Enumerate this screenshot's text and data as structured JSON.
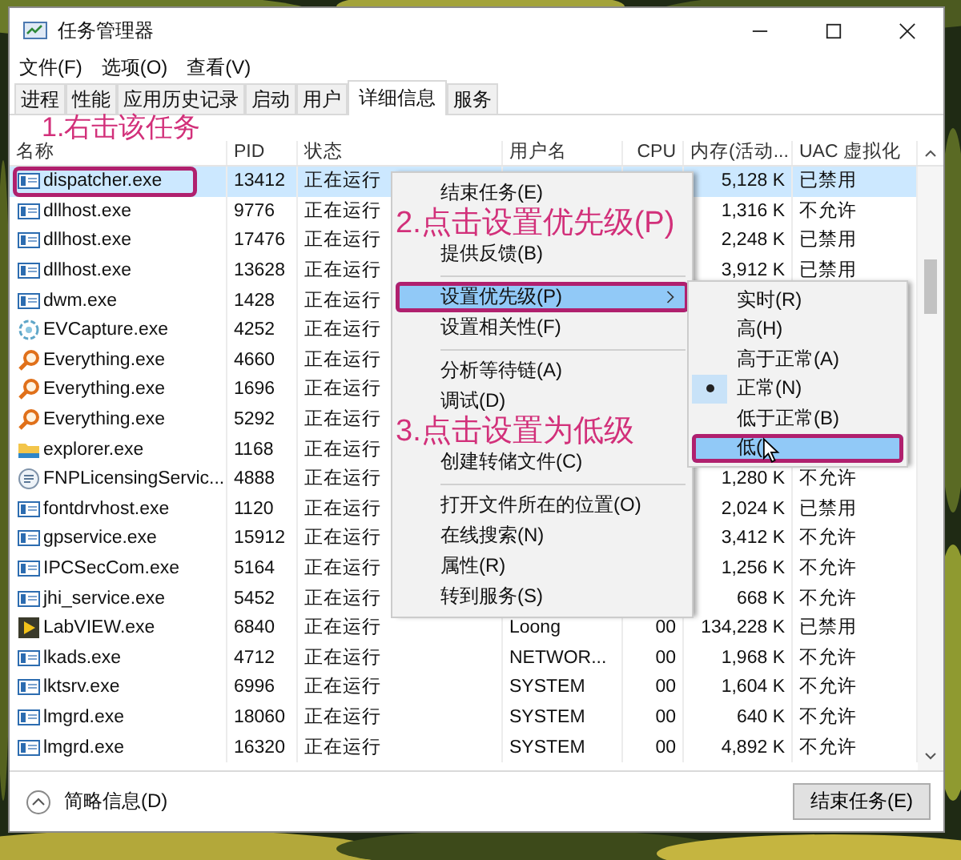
{
  "window": {
    "title": "任务管理器"
  },
  "menu_bar": [
    "文件(F)",
    "选项(O)",
    "查看(V)"
  ],
  "tabs": [
    {
      "label": "进程",
      "selected": false
    },
    {
      "label": "性能",
      "selected": false
    },
    {
      "label": "应用历史记录",
      "selected": false
    },
    {
      "label": "启动",
      "selected": false
    },
    {
      "label": "用户",
      "selected": false
    },
    {
      "label": "详细信息",
      "selected": true
    },
    {
      "label": "服务",
      "selected": false
    }
  ],
  "annotation": "1.右击该任务",
  "table": {
    "columns": [
      "名称",
      "PID",
      "状态",
      "用户名",
      "CPU",
      "内存(活动...",
      "UAC 虚拟化"
    ],
    "rows": [
      {
        "kind": "app",
        "name": "dispatcher.exe",
        "pid": "13412",
        "status": "正在运行",
        "memory": "5,128 K",
        "uac": "已禁用",
        "selected": true
      },
      {
        "kind": "app",
        "name": "dllhost.exe",
        "pid": "9776",
        "status": "正在运行",
        "memory": "1,316 K",
        "uac": "不允许",
        "selected": false
      },
      {
        "kind": "app",
        "name": "dllhost.exe",
        "pid": "17476",
        "status": "正在运行",
        "memory": "2,248 K",
        "uac": "已禁用",
        "selected": false
      },
      {
        "kind": "app",
        "name": "dllhost.exe",
        "pid": "13628",
        "status": "正在运行",
        "memory": "3,912 K",
        "uac": "已禁用",
        "selected": false
      },
      {
        "kind": "app",
        "name": "dwm.exe",
        "pid": "1428",
        "status": "正在运行",
        "selected": false
      },
      {
        "kind": "capture",
        "name": "EVCapture.exe",
        "pid": "4252",
        "status": "正在运行",
        "selected": false
      },
      {
        "kind": "search",
        "name": "Everything.exe",
        "pid": "4660",
        "status": "正在运行",
        "selected": false
      },
      {
        "kind": "search",
        "name": "Everything.exe",
        "pid": "1696",
        "status": "正在运行",
        "selected": false
      },
      {
        "kind": "search",
        "name": "Everything.exe",
        "pid": "5292",
        "status": "正在运行",
        "selected": false
      },
      {
        "kind": "folder",
        "name": "explorer.exe",
        "pid": "1168",
        "status": "正在运行",
        "selected": false
      },
      {
        "kind": "service",
        "name": "FNPLicensingServic...",
        "pid": "4888",
        "status": "正在运行",
        "memory": "1,280 K",
        "uac": "不允许",
        "selected": false
      },
      {
        "kind": "app",
        "name": "fontdrvhost.exe",
        "pid": "1120",
        "status": "正在运行",
        "memory": "2,024 K",
        "uac": "已禁用",
        "selected": false
      },
      {
        "kind": "app",
        "name": "gpservice.exe",
        "pid": "15912",
        "status": "正在运行",
        "memory": "3,412 K",
        "uac": "不允许",
        "selected": false
      },
      {
        "kind": "app",
        "name": "IPCSecCom.exe",
        "pid": "5164",
        "status": "正在运行",
        "memory": "1,256 K",
        "uac": "不允许",
        "selected": false
      },
      {
        "kind": "app",
        "name": "jhi_service.exe",
        "pid": "5452",
        "status": "正在运行",
        "memory": "668 K",
        "uac": "不允许",
        "selected": false
      },
      {
        "kind": "labview",
        "name": "LabVIEW.exe",
        "pid": "6840",
        "status": "正在运行",
        "user": "Loong",
        "cpu": "00",
        "memory": "134,228 K",
        "uac": "已禁用",
        "selected": false
      },
      {
        "kind": "app",
        "name": "lkads.exe",
        "pid": "4712",
        "status": "正在运行",
        "user": "NETWOR...",
        "cpu": "00",
        "memory": "1,968 K",
        "uac": "不允许",
        "selected": false
      },
      {
        "kind": "app",
        "name": "lktsrv.exe",
        "pid": "6996",
        "status": "正在运行",
        "user": "SYSTEM",
        "cpu": "00",
        "memory": "1,604 K",
        "uac": "不允许",
        "selected": false
      },
      {
        "kind": "app",
        "name": "lmgrd.exe",
        "pid": "18060",
        "status": "正在运行",
        "user": "SYSTEM",
        "cpu": "00",
        "memory": "640 K",
        "uac": "不允许",
        "selected": false
      },
      {
        "kind": "app",
        "name": "lmgrd.exe",
        "pid": "16320",
        "status": "正在运行",
        "user": "SYSTEM",
        "cpu": "00",
        "memory": "4,892 K",
        "uac": "不允许",
        "selected": false
      }
    ]
  },
  "context_menu": [
    {
      "kind": "item",
      "label": "结束任务(E)",
      "highlighted": false
    },
    {
      "kind": "annotation",
      "text": "2.点击设置优先级(P)"
    },
    {
      "kind": "item",
      "label": "提供反馈(B)",
      "highlighted": false
    },
    {
      "kind": "separator"
    },
    {
      "kind": "submenu",
      "label": "设置优先级(P)",
      "highlighted": true
    },
    {
      "kind": "item",
      "label": "设置相关性(F)",
      "highlighted": false
    },
    {
      "kind": "separator"
    },
    {
      "kind": "item",
      "label": "分析等待链(A)",
      "highlighted": false
    },
    {
      "kind": "item",
      "label": "调试(D)",
      "highlighted": false
    },
    {
      "kind": "annotation",
      "text": "3.点击设置为低级"
    },
    {
      "kind": "item",
      "label": "创建转储文件(C)",
      "highlighted": false
    },
    {
      "kind": "separator"
    },
    {
      "kind": "item",
      "label": "打开文件所在的位置(O)",
      "highlighted": false
    },
    {
      "kind": "item",
      "label": "在线搜索(N)",
      "highlighted": false
    },
    {
      "kind": "item",
      "label": "属性(R)",
      "highlighted": false
    },
    {
      "kind": "item",
      "label": "转到服务(S)",
      "highlighted": false
    }
  ],
  "priority_submenu": [
    {
      "label": "实时(R)",
      "selected": false,
      "highlighted": false
    },
    {
      "label": "高(H)",
      "selected": false,
      "highlighted": false
    },
    {
      "label": "高于正常(A)",
      "selected": false,
      "highlighted": false
    },
    {
      "label": "正常(N)",
      "selected": true,
      "highlighted": false
    },
    {
      "label": "低于正常(B)",
      "selected": false,
      "highlighted": false
    },
    {
      "label": "低(",
      "selected": false,
      "highlighted": true
    }
  ],
  "footer": {
    "details_toggle": "简略信息(D)",
    "end_task_button": "结束任务(E)"
  }
}
